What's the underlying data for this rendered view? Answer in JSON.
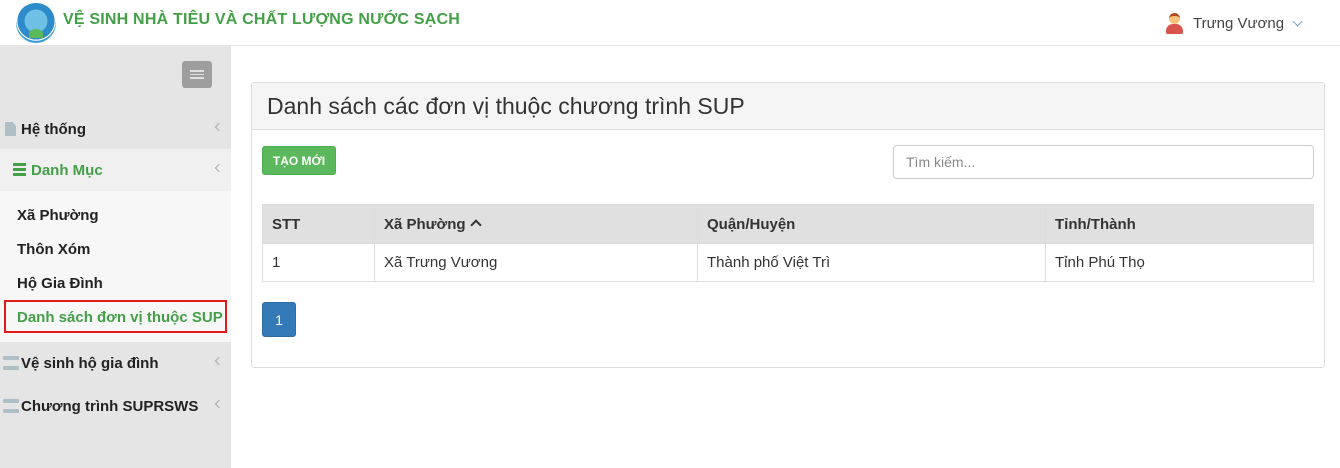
{
  "header": {
    "app_title": "VỆ SINH NHÀ TIÊU VÀ CHẤT LƯỢNG NƯỚC SẠCH",
    "user_name": "Trưng Vương"
  },
  "sidebar": {
    "items": [
      {
        "label": "Hệ thống",
        "icon": "document-icon"
      },
      {
        "label": "Danh Mục",
        "icon": "list-icon",
        "expanded": true,
        "children": [
          "Xã Phường",
          "Thôn Xóm",
          "Hộ Gia Đình",
          "Danh sách đơn vị thuộc SUP"
        ],
        "active_child": "Danh sách đơn vị thuộc SUP"
      },
      {
        "label": "Vệ sinh hộ gia đình",
        "icon": "server-icon"
      },
      {
        "label": "Chương trình SUPRSWS",
        "icon": "server-icon"
      }
    ]
  },
  "main": {
    "panel_title": "Danh sách các đơn vị thuộc chương trình SUP",
    "new_button_label": "TẠO MỚI",
    "search_placeholder": "Tìm kiếm...",
    "table": {
      "columns": [
        "STT",
        "Xã Phường",
        "Quận/Huyện",
        "Tỉnh/Thành"
      ],
      "sorted_column": "Xã Phường",
      "rows": [
        [
          "1",
          "Xã Trưng Vương",
          "Thành phố Việt Trì",
          "Tỉnh Phú Thọ"
        ]
      ]
    },
    "pagination": {
      "current_page": "1"
    }
  },
  "colors": {
    "accent_green": "#43a047",
    "button_green": "#5cb85c",
    "page_blue": "#337ab7",
    "highlight_red": "#e01b1b"
  }
}
